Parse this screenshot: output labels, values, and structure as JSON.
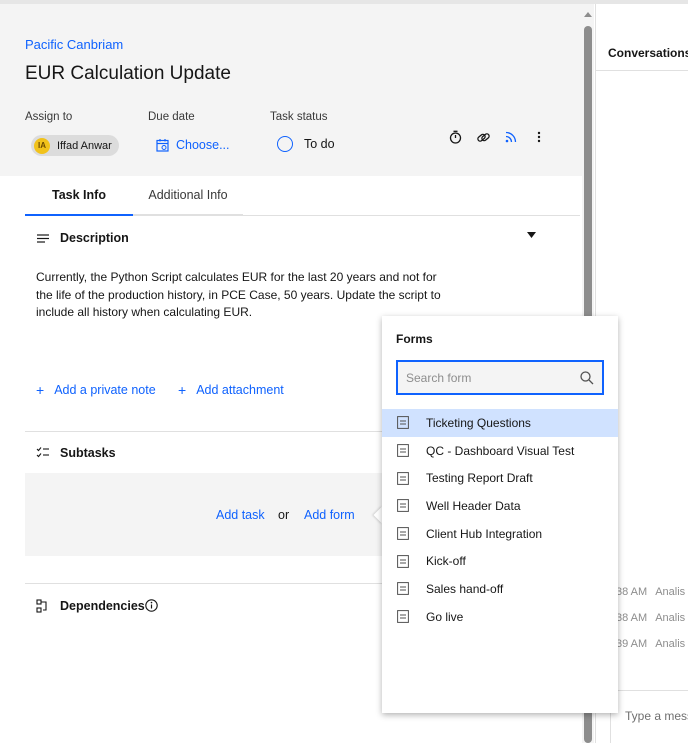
{
  "task": {
    "breadcrumb": "Pacific Canbriam",
    "title": "EUR Calculation Update",
    "assign_to_label": "Assign to",
    "assignee": {
      "initials": "IA",
      "name": "Iffad Anwar"
    },
    "due_date_label": "Due date",
    "due_date_value": "Choose...",
    "status_label": "Task status",
    "status_value": "To do",
    "header_icons": [
      "timer-icon",
      "link-icon",
      "rss-feed-icon",
      "overflow-menu-icon"
    ]
  },
  "tabs": [
    {
      "label": "Task Info",
      "active": true
    },
    {
      "label": "Additional Info",
      "active": false
    }
  ],
  "description": {
    "title": "Description",
    "text": "Currently, the Python Script calculates EUR for the last 20 years and not for the life of the production history, in PCE Case, 50 years.  Update the script to include all history when calculating EUR."
  },
  "actions": {
    "add_note": "Add a private note",
    "add_attachment": "Add attachment"
  },
  "subtasks": {
    "title": "Subtasks",
    "add_task": "Add task",
    "or": "or",
    "add_form": "Add form"
  },
  "dependencies": {
    "title": "Dependencies"
  },
  "conversations": {
    "title": "Conversations",
    "rows": [
      {
        "time": "38 AM",
        "who": "Analis"
      },
      {
        "time": "38 AM",
        "who": "Analis"
      },
      {
        "time": "39 AM",
        "who": "Analis"
      }
    ],
    "input_placeholder": "Type a mess"
  },
  "forms": {
    "title": "Forms",
    "search_placeholder": "Search form",
    "items": [
      "Ticketing Questions",
      "QC - Dashboard Visual Test",
      "Testing Report Draft",
      "Well Header Data",
      "Client Hub Integration",
      "Kick-off",
      "Sales hand-off",
      "Go live"
    ],
    "selected_index": 0
  },
  "colors": {
    "accent": "#0f62fe",
    "selected_row": "#d0e2ff",
    "avatar": "#f1c21b"
  }
}
